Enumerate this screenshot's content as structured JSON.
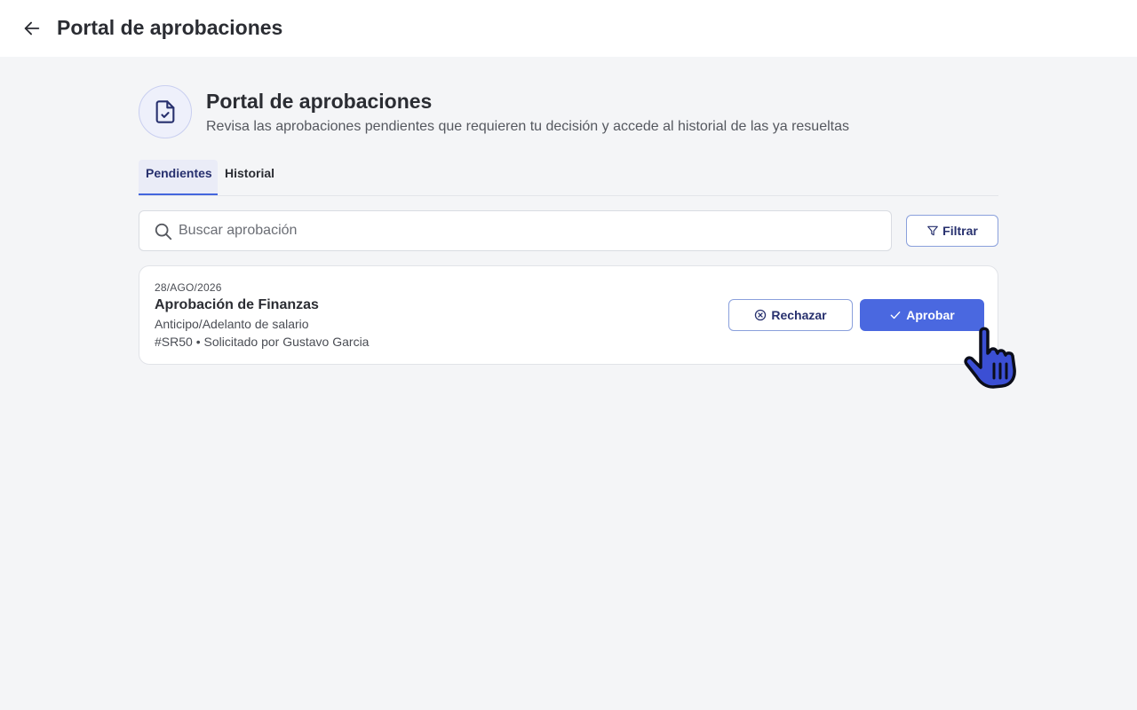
{
  "topbar": {
    "title": "Portal de aprobaciones",
    "back_icon": "arrow-left-icon"
  },
  "hero": {
    "icon": "document-check-icon",
    "title": "Portal de aprobaciones",
    "subtitle": "Revisa las aprobaciones pendientes que requieren tu decisión y accede al historial de las ya resueltas"
  },
  "tabs": [
    {
      "label": "Pendientes",
      "active": true
    },
    {
      "label": "Historial",
      "active": false
    }
  ],
  "search": {
    "placeholder": "Buscar aprobación",
    "value": "",
    "icon": "search-icon"
  },
  "filter": {
    "label": "Filtrar",
    "icon": "filter-icon"
  },
  "approvals": [
    {
      "date": "28/AGO/2026",
      "title": "Aprobación de Finanzas",
      "type": "Anticipo/Adelanto de salario",
      "meta": "#SR50 • Solicitado por Gustavo Garcia",
      "reject_label": "Rechazar",
      "approve_label": "Aprobar"
    }
  ],
  "colors": {
    "accent": "#4a68e0",
    "accent_dark": "#27306e",
    "background": "#f4f5f7",
    "cursor_fill": "#3b4fd4"
  }
}
